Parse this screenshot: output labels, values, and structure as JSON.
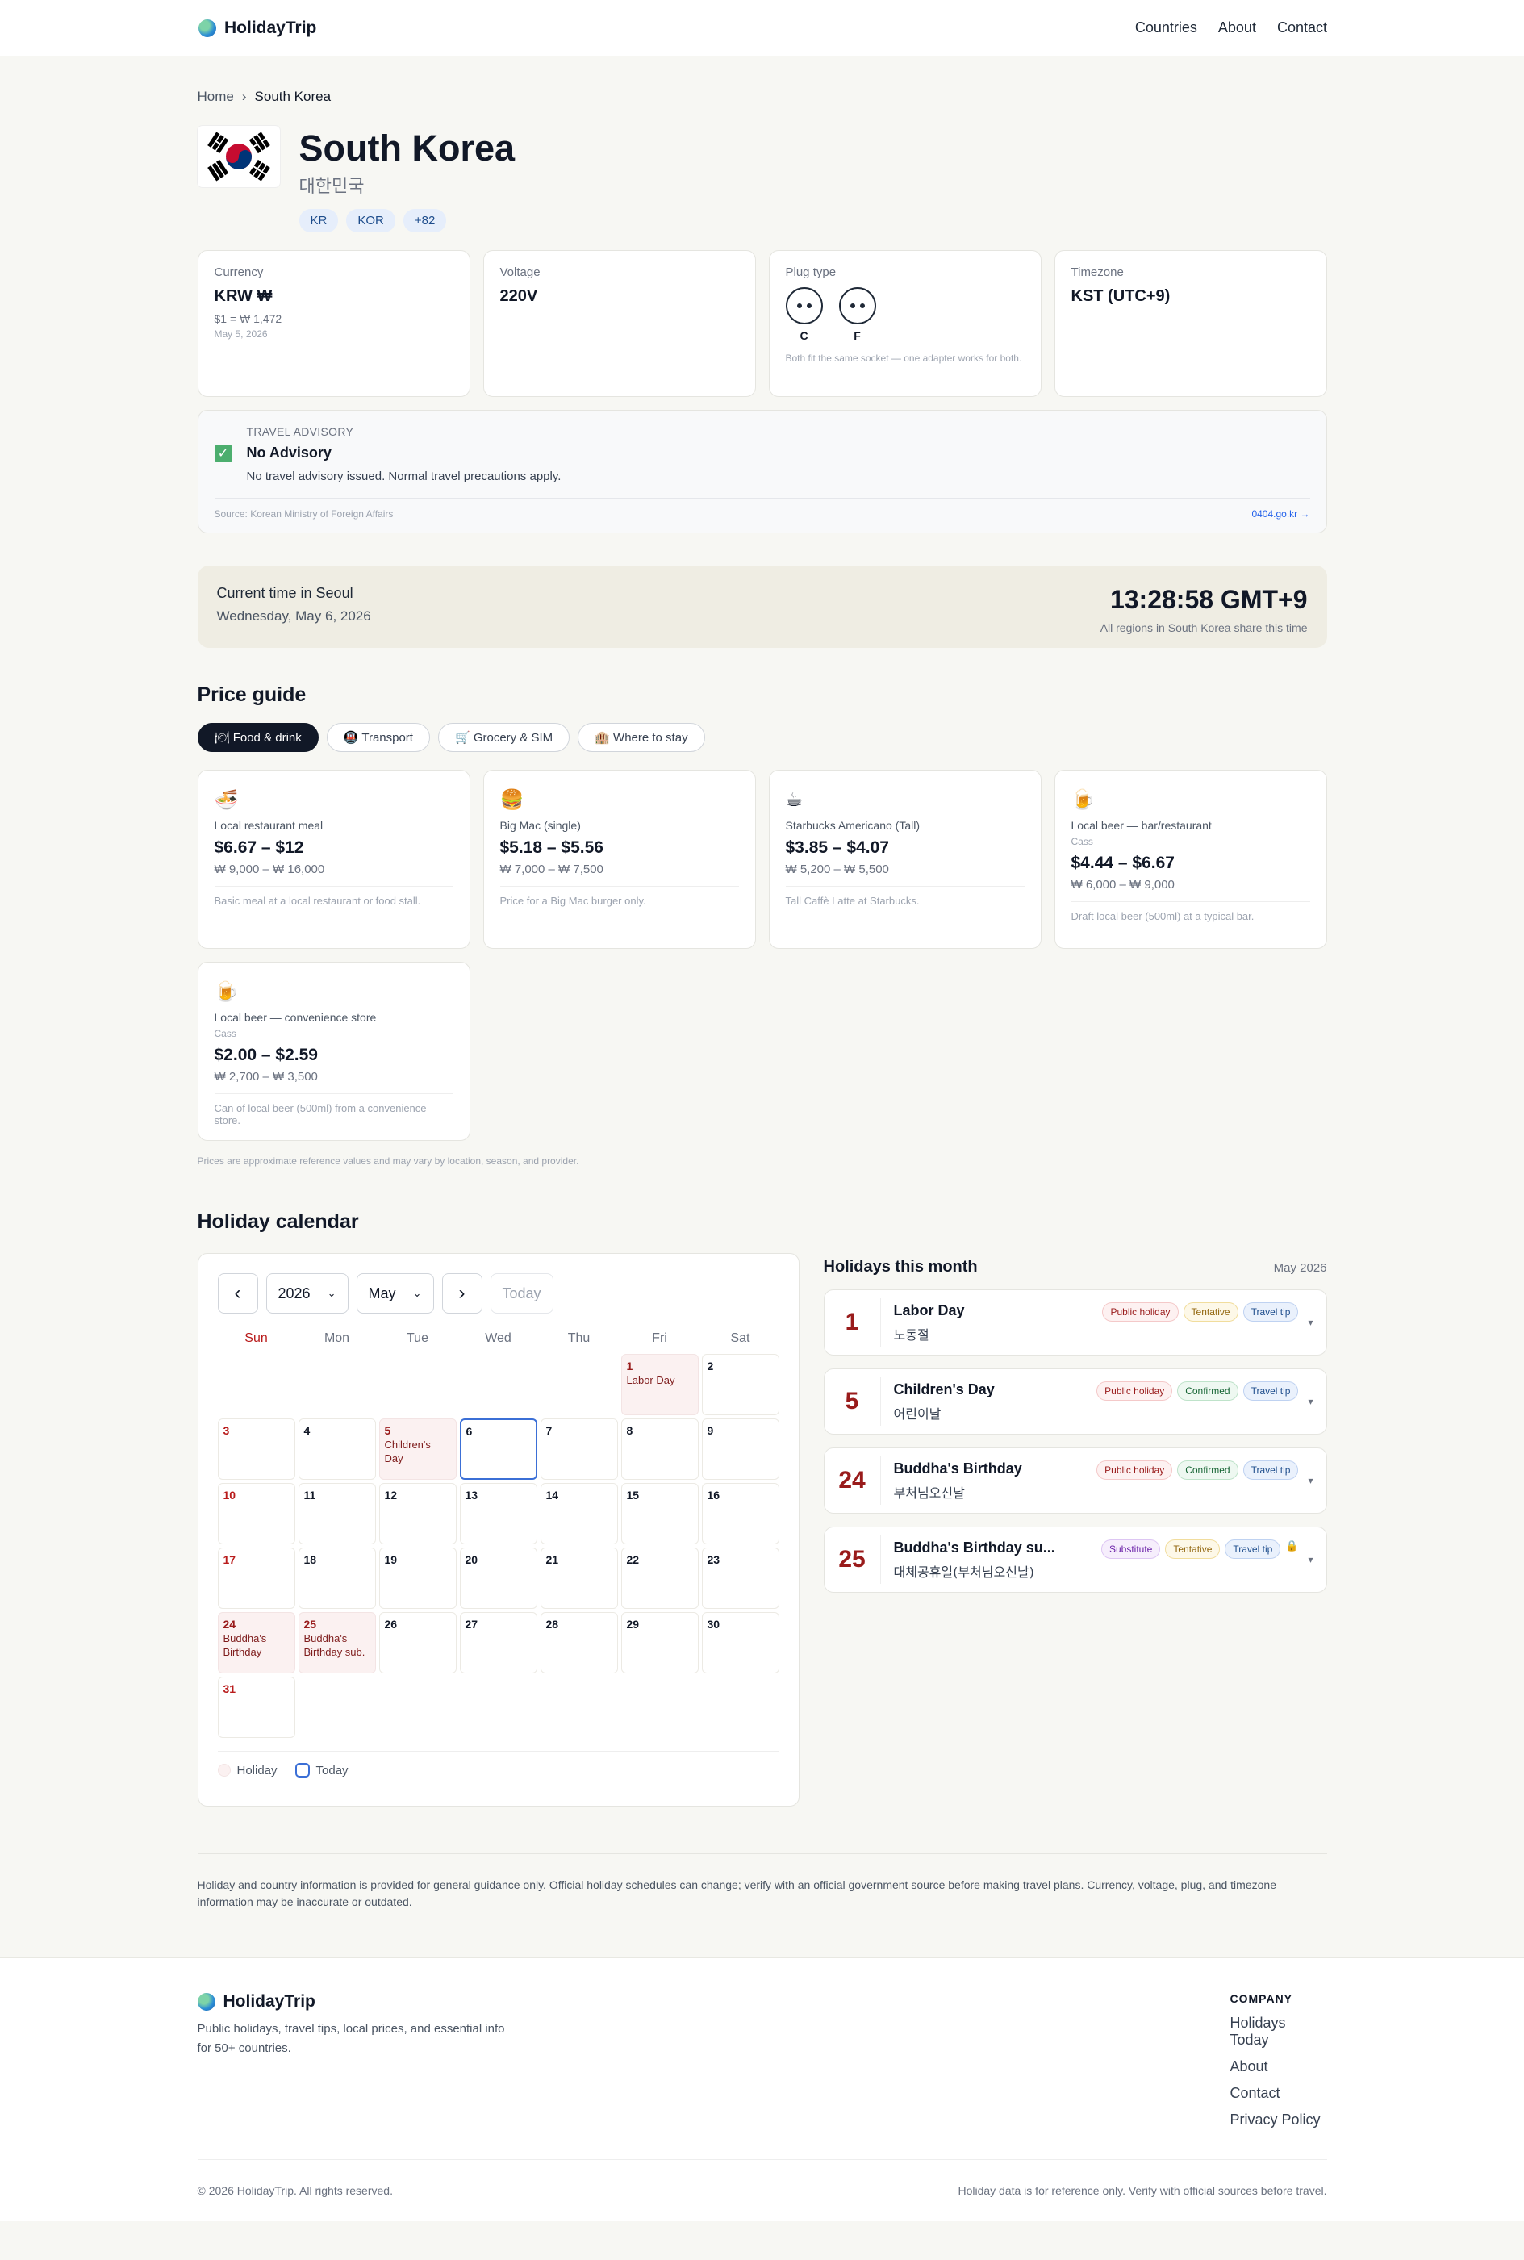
{
  "header": {
    "brand": "HolidayTrip",
    "nav": [
      "Countries",
      "About",
      "Contact"
    ]
  },
  "breadcrumb": {
    "home": "Home",
    "sep": "›",
    "current": "South Korea"
  },
  "country": {
    "name": "South Korea",
    "native": "대한민국",
    "codes": [
      "KR",
      "KOR",
      "+82"
    ]
  },
  "facts": {
    "currency": {
      "label": "Currency",
      "value": "KRW ₩",
      "rate": "$1 = ₩ 1,472",
      "date": "May 5, 2026"
    },
    "voltage": {
      "label": "Voltage",
      "value": "220V"
    },
    "plug": {
      "label": "Plug type",
      "types": [
        "C",
        "F"
      ],
      "note": "Both fit the same socket — one adapter works for both."
    },
    "timezone": {
      "label": "Timezone",
      "value": "KST (UTC+9)"
    }
  },
  "advisory": {
    "label": "TRAVEL ADVISORY",
    "title": "No Advisory",
    "desc": "No travel advisory issued. Normal travel precautions apply.",
    "source": "Source: Korean Ministry of Foreign Affairs",
    "link": "0404.go.kr →"
  },
  "time": {
    "label": "Current time in Seoul",
    "date": "Wednesday, May 6, 2026",
    "clock": "13:28:58 GMT+9",
    "note": "All regions in South Korea share this time"
  },
  "prices": {
    "title": "Price guide",
    "tabs": [
      "🍽 Food & drink",
      "🚇 Transport",
      "🛒 Grocery & SIM",
      "🏨 Where to stay"
    ],
    "active_tab": 0,
    "items": [
      {
        "icon": "🍜",
        "name": "Local restaurant meal",
        "brand": "",
        "usd": "$6.67 – $12",
        "krw": "₩ 9,000 – ₩ 16,000",
        "desc": "Basic meal at a local restaurant or food stall."
      },
      {
        "icon": "🍔",
        "name": "Big Mac (single)",
        "brand": "",
        "usd": "$5.18 – $5.56",
        "krw": "₩ 7,000 – ₩ 7,500",
        "desc": "Price for a Big Mac burger only."
      },
      {
        "icon": "☕",
        "name": "Starbucks Americano (Tall)",
        "brand": "",
        "usd": "$3.85 – $4.07",
        "krw": "₩ 5,200 – ₩ 5,500",
        "desc": "Tall Caffè Latte at Starbucks."
      },
      {
        "icon": "🍺",
        "name": "Local beer — bar/restaurant",
        "brand": "Cass",
        "usd": "$4.44 – $6.67",
        "krw": "₩ 6,000 – ₩ 9,000",
        "desc": "Draft local beer (500ml) at a typical bar."
      },
      {
        "icon": "🍺",
        "name": "Local beer — convenience store",
        "brand": "Cass",
        "usd": "$2.00 – $2.59",
        "krw": "₩ 2,700 – ₩ 3,500",
        "desc": "Can of local beer (500ml) from a convenience store."
      }
    ],
    "note": "Prices are approximate reference values and may vary by location, season, and provider."
  },
  "calendar": {
    "title": "Holiday calendar",
    "year": "2026",
    "month": "May",
    "today_label": "Today",
    "dows": [
      "Sun",
      "Mon",
      "Tue",
      "Wed",
      "Thu",
      "Fri",
      "Sat"
    ],
    "first_weekday": 5,
    "days_in_month": 31,
    "today": 6,
    "holidays": {
      "1": "Labor Day",
      "5": "Children's Day",
      "24": "Buddha's Birthday",
      "25": "Buddha's Birthday sub."
    },
    "legend": {
      "holiday": "Holiday",
      "today": "Today"
    }
  },
  "holiday_list": {
    "title": "Holidays this month",
    "month": "May 2026",
    "items": [
      {
        "day": "1",
        "name": "Labor Day",
        "local": "노동절",
        "badges": [
          [
            "Public holiday",
            "pub"
          ],
          [
            "Tentative",
            "ten"
          ],
          [
            "Travel tip",
            "tip"
          ]
        ],
        "lock": false
      },
      {
        "day": "5",
        "name": "Children's Day",
        "local": "어린이날",
        "badges": [
          [
            "Public holiday",
            "pub"
          ],
          [
            "Confirmed",
            "con"
          ],
          [
            "Travel tip",
            "tip"
          ]
        ],
        "lock": false
      },
      {
        "day": "24",
        "name": "Buddha's Birthday",
        "local": "부처님오신날",
        "badges": [
          [
            "Public holiday",
            "pub"
          ],
          [
            "Confirmed",
            "con"
          ],
          [
            "Travel tip",
            "tip"
          ]
        ],
        "lock": false
      },
      {
        "day": "25",
        "name": "Buddha's Birthday su...",
        "local": "대체공휴일(부처님오신날)",
        "badges": [
          [
            "Substitute",
            "sub"
          ],
          [
            "Tentative",
            "ten"
          ],
          [
            "Travel tip",
            "tip"
          ]
        ],
        "lock": true
      }
    ]
  },
  "disclaimer": "Holiday and country information is provided for general guidance only. Official holiday schedules can change; verify with an official government source before making travel plans. Currency, voltage, plug, and timezone information may be inaccurate or outdated.",
  "footer": {
    "brand": "HolidayTrip",
    "tagline": "Public holidays, travel tips, local prices, and essential info for 50+ countries.",
    "col_title": "COMPANY",
    "links": [
      "Holidays Today",
      "About",
      "Contact",
      "Privacy Policy"
    ],
    "copyright": "© 2026 HolidayTrip. All rights reserved.",
    "note": "Holiday data is for reference only. Verify with official sources before travel."
  }
}
